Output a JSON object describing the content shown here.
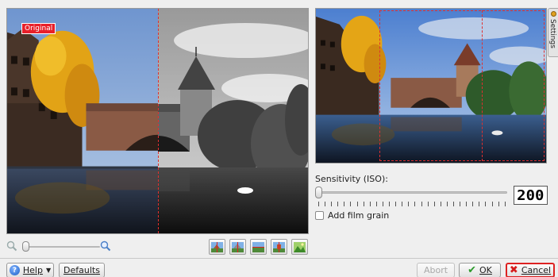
{
  "preview": {
    "original_label": "Original"
  },
  "settings": {
    "tab_label": "Settings",
    "sensitivity_label": "Sensitivity (ISO):",
    "iso_value": "200",
    "add_film_grain": "Add film grain",
    "add_film_grain_checked": false
  },
  "view_buttons": [
    {
      "name": "original-vs-target-split-icon"
    },
    {
      "name": "split-view-icon"
    },
    {
      "name": "horizontal-split-icon"
    },
    {
      "name": "vertical-split-icon"
    },
    {
      "name": "target-image-icon"
    }
  ],
  "buttons": {
    "help": "Help",
    "defaults": "Defaults",
    "abort": "Abort",
    "ok": "OK",
    "cancel": "Cancel"
  },
  "colors": {
    "split_line": "#e03030",
    "ok_accent": "#2a9a2a",
    "cancel_accent": "#d51c1c",
    "focus_border": "#dd2222"
  }
}
